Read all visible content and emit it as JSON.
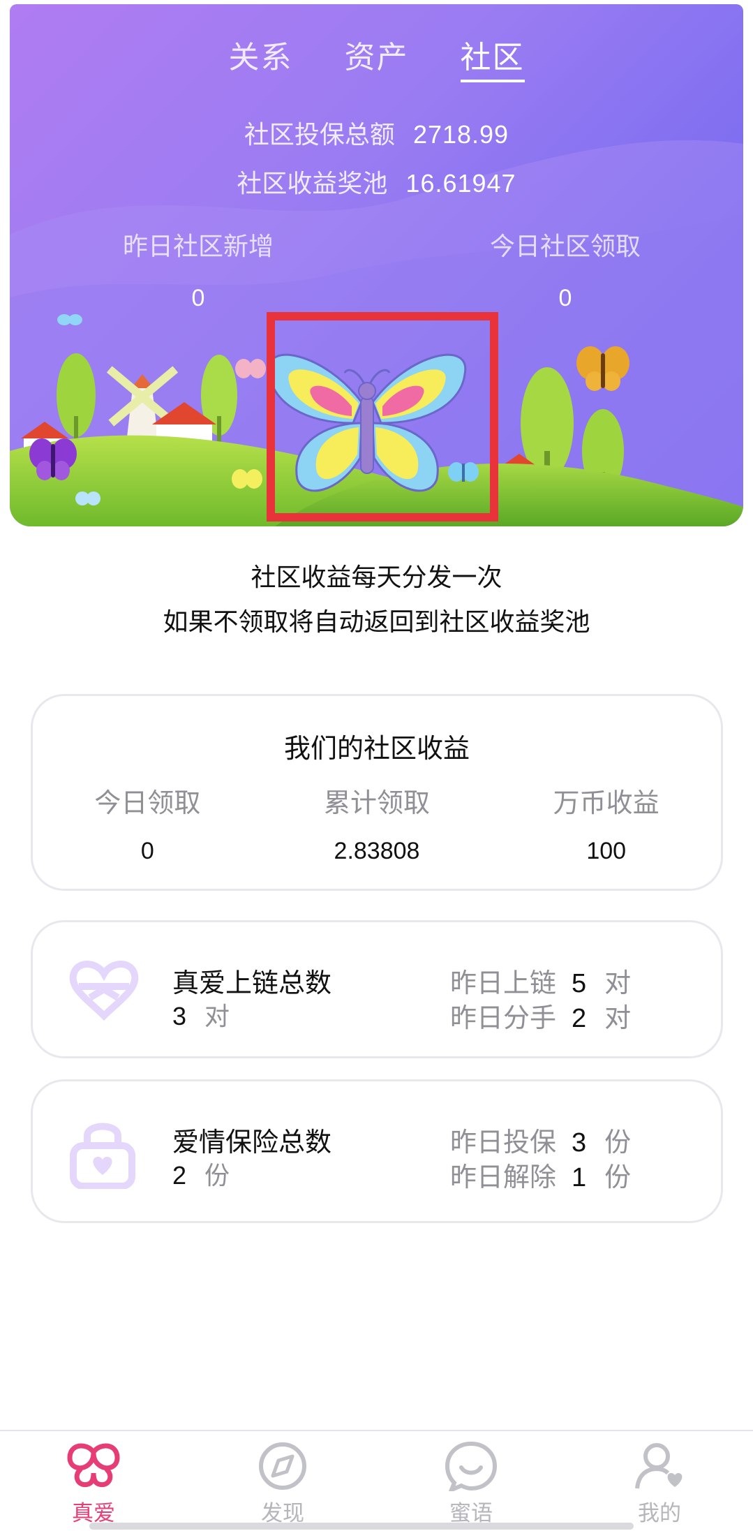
{
  "tabs": [
    "关系",
    "资产",
    "社区"
  ],
  "active_tab": "社区",
  "community": {
    "insured_total_label": "社区投保总额",
    "insured_total_value": "2718.99",
    "pool_label": "社区收益奖池",
    "pool_value": "16.61947",
    "yesterday_new_label": "昨日社区新增",
    "yesterday_new_value": "0",
    "today_claim_label": "今日社区领取",
    "today_claim_value": "0"
  },
  "notice": {
    "line1": "社区收益每天分发一次",
    "line2": "如果不领取将自动返回到社区收益奖池"
  },
  "earnings_card": {
    "title": "我们的社区收益",
    "cols": [
      {
        "label": "今日领取",
        "value": "0"
      },
      {
        "label": "累计领取",
        "value": "2.83808"
      },
      {
        "label": "万币收益",
        "value": "100"
      }
    ]
  },
  "love_card": {
    "label": "真爱上链总数",
    "value": "3",
    "unit": "对",
    "rows": [
      {
        "label": "昨日上链",
        "value": "5",
        "unit": "对"
      },
      {
        "label": "昨日分手",
        "value": "2",
        "unit": "对"
      }
    ]
  },
  "insurance_card": {
    "label": "爱情保险总数",
    "value": "2",
    "unit": "份",
    "rows": [
      {
        "label": "昨日投保",
        "value": "3",
        "unit": "份"
      },
      {
        "label": "昨日解除",
        "value": "1",
        "unit": "份"
      }
    ]
  },
  "bottom_nav": [
    {
      "label": "真爱",
      "icon": "love-knot-icon",
      "active": true
    },
    {
      "label": "发现",
      "icon": "compass-icon",
      "active": false
    },
    {
      "label": "蜜语",
      "icon": "chat-smile-icon",
      "active": false
    },
    {
      "label": "我的",
      "icon": "profile-heart-icon",
      "active": false
    }
  ],
  "colors": {
    "hero_gradient_start": "#b07cf2",
    "hero_gradient_end": "#6e63ee",
    "highlight_box": "#e8333a",
    "active_nav": "#e63e74",
    "inactive_nav": "#b5b5bb",
    "icon_lavender": "#e4d7fb"
  }
}
